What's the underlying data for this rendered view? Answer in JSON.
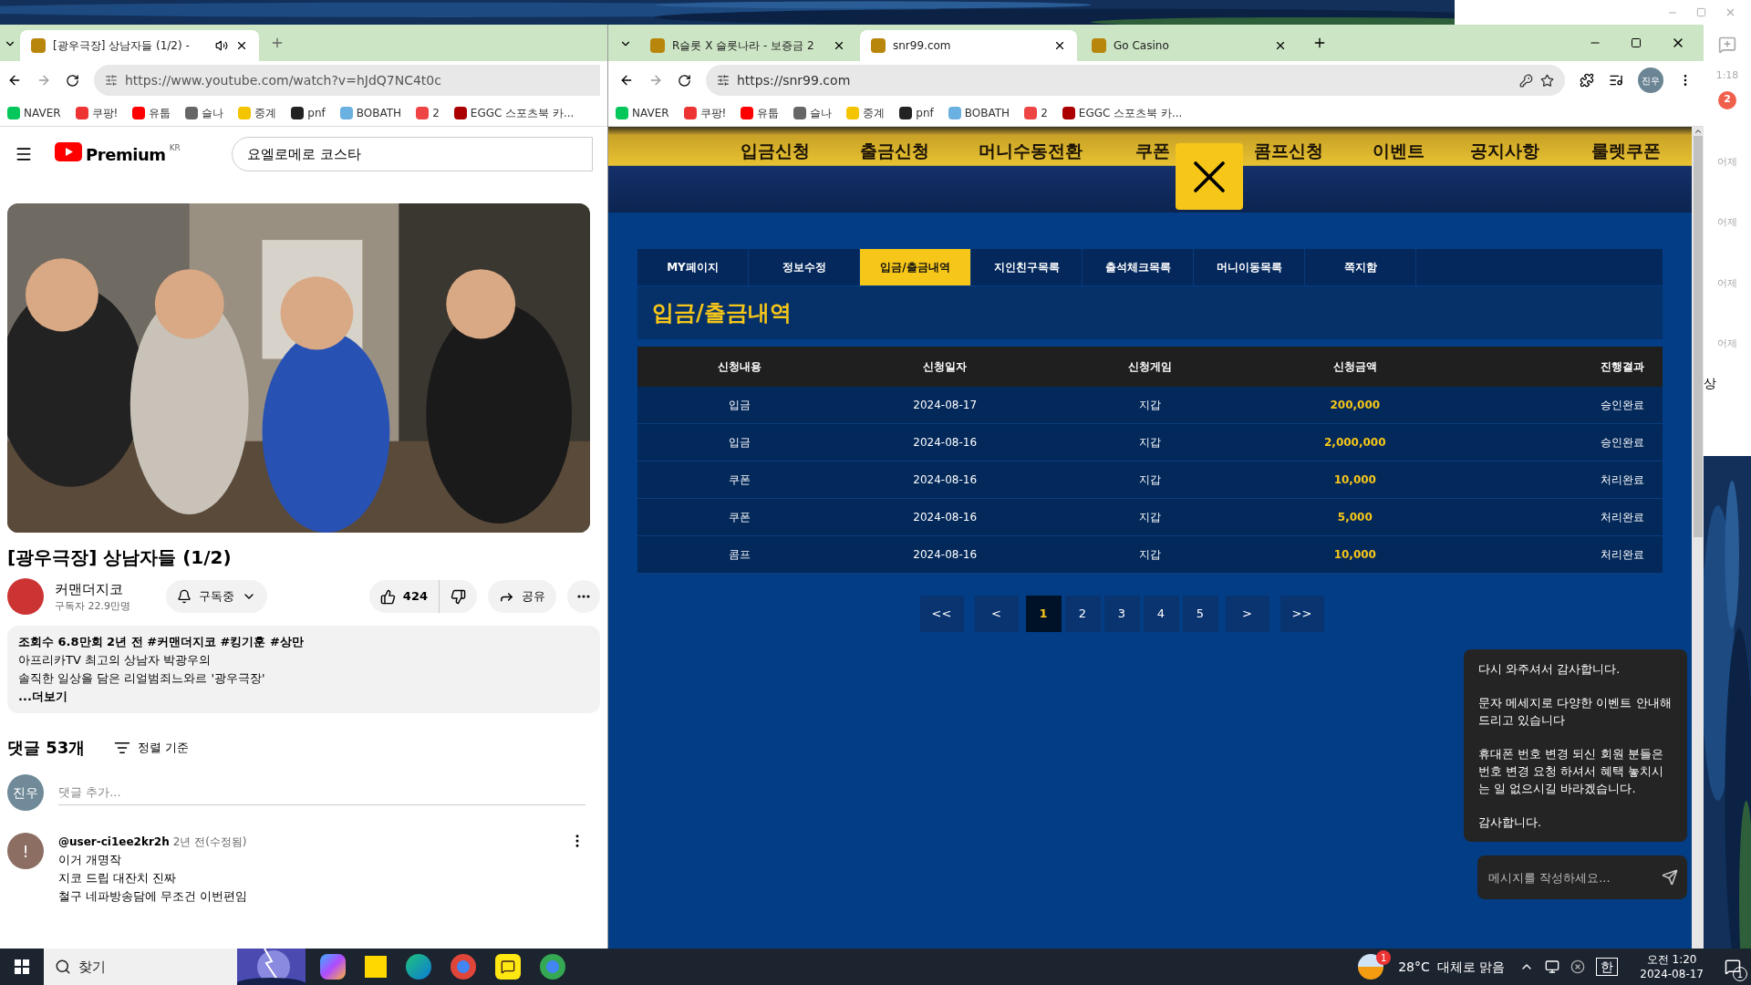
{
  "youtube_window": {
    "tabs": [
      {
        "title": "[광우극장] 상남자들 (1/2) -",
        "selected": true,
        "audio": true
      }
    ],
    "address": "https://www.youtube.com/watch?v=hJdQ7NC4t0c",
    "bookmarks": [
      "NAVER",
      "쿠팡!",
      "유툽",
      "슬나",
      "중계",
      "pnf",
      "BOBATH",
      "2",
      "EGGC 스포츠북 카..."
    ],
    "logo": "Premium",
    "logo_region": "KR",
    "search": "요엘로메로 코스타",
    "video_title": "[광우극장] 상남자들 (1/2)",
    "channel": {
      "name": "커맨더지코",
      "subscribers": "구독자 22.9만명"
    },
    "subscribe": "구독중",
    "likes": "424",
    "share": "공유",
    "description": {
      "meta": "조회수 6.8만회  2년 전  #커맨더지코 #킹기훈 #상만",
      "lines": [
        "아프리카TV 최고의 상남자 박광우의",
        "솔직한 일상을 담은 리얼범죄느와르 '광우극장'"
      ],
      "more": "...더보기"
    },
    "comments": {
      "count": "댓글 53개",
      "sort": "정렬 기준",
      "avatar": "진우",
      "placeholder": "댓글 추가...",
      "items": [
        {
          "avatar": "!",
          "author": "@user-ci1ee2kr2h",
          "time": "2년 전(수정됨)",
          "lines": [
            "이거 개명작",
            "지코 드립 대잔치 진짜",
            "철구 네파방송담에 무조건 이번편임"
          ]
        }
      ]
    }
  },
  "site_window": {
    "tabs": [
      {
        "title": "R슬롯 X 슬롯나라 - 보증금 2",
        "selected": false
      },
      {
        "title": "snr99.com",
        "selected": true
      },
      {
        "title": "Go Casino",
        "selected": false
      }
    ],
    "address": "https://snr99.com",
    "profile": "진우",
    "bookmarks": [
      "NAVER",
      "쿠팡!",
      "유툽",
      "슬나",
      "중계",
      "pnf",
      "BOBATH",
      "2",
      "EGGC 스포츠북 카..."
    ],
    "nav": [
      "입금신청",
      "출금신청",
      "머니수동전환",
      "쿠폰",
      "콤프신청",
      "이벤트",
      "공지사항",
      "룰렛쿠폰"
    ],
    "menu": [
      {
        "label": "MY페이지",
        "selected": false
      },
      {
        "label": "정보수정",
        "selected": false
      },
      {
        "label": "입금/출금내역",
        "selected": true
      },
      {
        "label": "지인친구목록",
        "selected": false
      },
      {
        "label": "출석체크목록",
        "selected": false
      },
      {
        "label": "머니이동목록",
        "selected": false
      },
      {
        "label": "쪽지함",
        "selected": false
      }
    ],
    "heading": "입금/출금내역",
    "table": {
      "columns": [
        "신청내용",
        "신청일자",
        "신청게임",
        "신청금액",
        "진행결과"
      ],
      "rows": [
        [
          "입금",
          "2024-08-17",
          "지갑",
          "200,000",
          "승인완료"
        ],
        [
          "입금",
          "2024-08-16",
          "지갑",
          "2,000,000",
          "승인완료"
        ],
        [
          "쿠폰",
          "2024-08-16",
          "지갑",
          "10,000",
          "처리완료"
        ],
        [
          "쿠폰",
          "2024-08-16",
          "지갑",
          "5,000",
          "처리완료"
        ],
        [
          "콤프",
          "2024-08-16",
          "지갑",
          "10,000",
          "처리완료"
        ]
      ]
    },
    "pagination": [
      {
        "label": "<<",
        "kind": "nav",
        "selected": false
      },
      {
        "label": "<",
        "kind": "nav",
        "selected": false
      },
      {
        "label": "1",
        "kind": "page",
        "selected": true
      },
      {
        "label": "2",
        "kind": "page",
        "selected": false
      },
      {
        "label": "3",
        "kind": "page",
        "selected": false
      },
      {
        "label": "4",
        "kind": "page",
        "selected": false
      },
      {
        "label": "5",
        "kind": "page",
        "selected": false
      },
      {
        "label": ">",
        "kind": "nav",
        "selected": false
      },
      {
        "label": ">>",
        "kind": "nav",
        "selected": false
      }
    ],
    "chat": {
      "paragraphs": [
        "다시 와주셔서 감사합니다.",
        "문자 메세지로 다양한 이벤트 안내해드리고 있습니다",
        "휴대폰 번호 변경 되신 회원 분들은 번호 변경 요청 하셔서 혜택 놓치시는 일 없으시길 바라겠습니다.",
        "감사합니다."
      ],
      "placeholder": "메시지를 작성하세요..."
    }
  },
  "messenger": {
    "time": "1:18",
    "badge": "2",
    "dates": [
      "어제",
      "어제",
      "어제",
      "어제"
    ],
    "item": "상"
  },
  "taskbar": {
    "search": "찾기",
    "weather_badge": "1",
    "weather": "28°C",
    "weather_text": "대체로 맑음",
    "ime": "한",
    "time": "오전 1:20",
    "date": "2024-08-17",
    "notifications": "1"
  }
}
